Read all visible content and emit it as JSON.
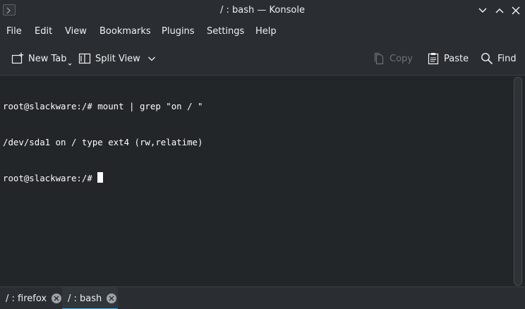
{
  "window": {
    "title": "/ : bash — Konsole"
  },
  "menubar": {
    "items": [
      "File",
      "Edit",
      "View",
      "Bookmarks",
      "Plugins",
      "Settings",
      "Help"
    ]
  },
  "toolbar": {
    "new_tab": "New Tab",
    "split_view": "Split View",
    "copy": "Copy",
    "paste": "Paste",
    "find": "Find"
  },
  "terminal": {
    "lines": [
      "root@slackware:/# mount | grep \"on / \"",
      "/dev/sda1 on / type ext4 (rw,relatime)"
    ],
    "prompt": "root@slackware:/# "
  },
  "tabs": [
    {
      "label": "/ : firefox",
      "active": false
    },
    {
      "label": "/ : bash",
      "active": true
    }
  ],
  "colors": {
    "accent": "#3daee9",
    "background": "#2a2e32",
    "terminal_background": "#232629",
    "text": "#eff0f1"
  }
}
